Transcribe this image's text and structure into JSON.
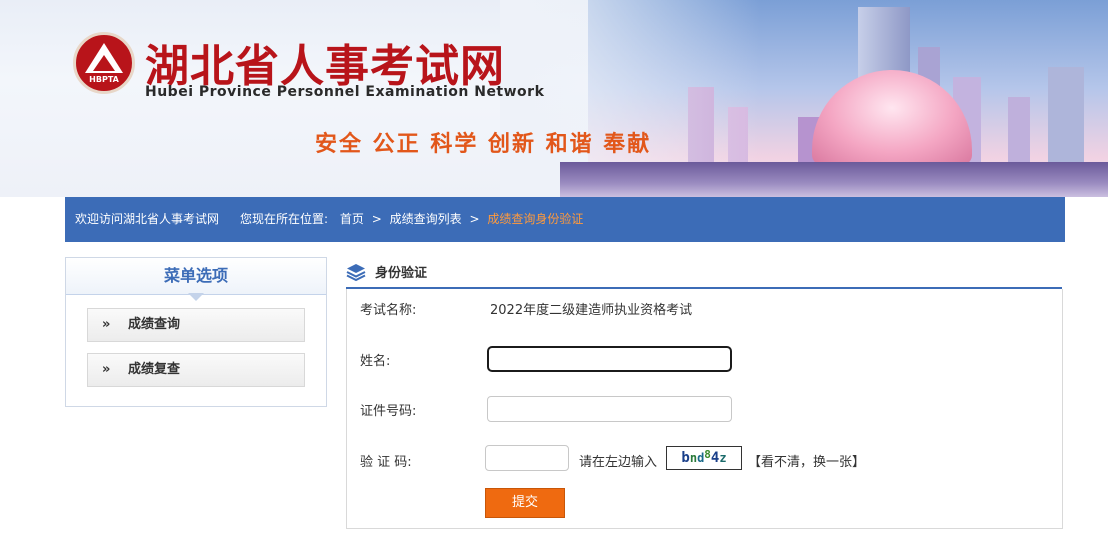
{
  "header": {
    "logo_abbr": "HBPTA",
    "title": "湖北省人事考试网",
    "subtitle": "Hubei Province Personnel Examination Network",
    "slogan": "安全 公正 科学 创新 和谐 奉献"
  },
  "navbar": {
    "welcome": "欢迎访问湖北省人事考试网",
    "location_label": "您现在所在位置:",
    "breadcrumb": [
      "首页",
      "成绩查询列表",
      "成绩查询身份验证"
    ],
    "separator": ">"
  },
  "sidebar": {
    "title": "菜单选项",
    "items": [
      {
        "label": "成绩查询",
        "chevron": "»"
      },
      {
        "label": "成绩复查",
        "chevron": "»"
      }
    ]
  },
  "form": {
    "section_title": "身份验证",
    "exam_label": "考试名称:",
    "exam_value": "2022年度二级建造师执业资格考试",
    "name_label": "姓名:",
    "name_value": "",
    "id_label": "证件号码:",
    "id_value": "",
    "captcha_label": "验 证 码:",
    "captcha_value": "",
    "captcha_hint": "请在左边输入",
    "captcha_chars": [
      "b",
      "n",
      "d",
      "8",
      "4",
      "z"
    ],
    "captcha_colors": [
      "#1a3f8a",
      "#2a7a3a",
      "#1a6a8a",
      "#3a8a2a",
      "#1a3f8a",
      "#1a6a6a"
    ],
    "refresh_link": "【看不清，换一张】",
    "submit_label": "提交"
  },
  "colors": {
    "brand_red": "#b8141a",
    "nav_blue": "#3c6cb7",
    "highlight_orange": "#ff9a3c",
    "submit_orange": "#ef6a10"
  }
}
